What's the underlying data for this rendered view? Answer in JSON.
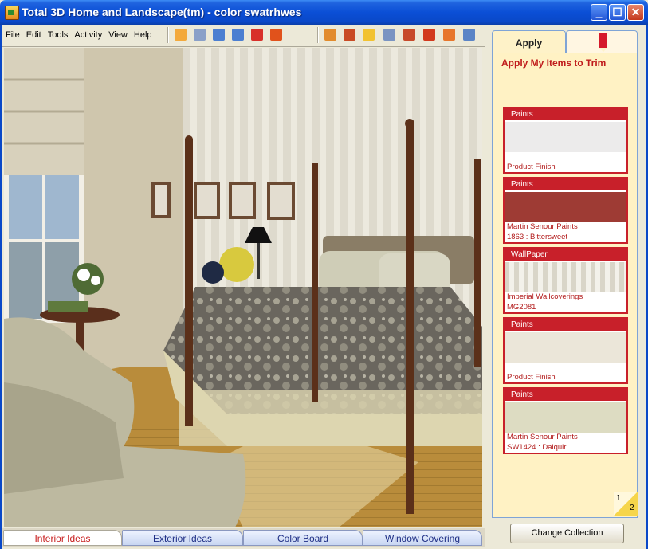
{
  "window": {
    "title": "Total 3D Home and Landscape(tm) - color swatrhwes"
  },
  "menu": [
    "File",
    "Edit",
    "Tools",
    "Activity",
    "View",
    "Help"
  ],
  "toolbar_icons": [
    "save-icon",
    "print-icon",
    "undo-icon",
    "redo-icon",
    "help-icon",
    "whats-this-icon",
    "catalog-icon",
    "house-icon",
    "lightbulb-icon",
    "materials-icon",
    "cart-icon",
    "book-icon",
    "rotate-icon",
    "zoom-icon"
  ],
  "bottom_tabs": [
    {
      "label": "Interior Ideas",
      "active": true
    },
    {
      "label": "Exterior Ideas",
      "active": false
    },
    {
      "label": "Color Board",
      "active": false
    },
    {
      "label": "Window Covering",
      "active": false
    }
  ],
  "panel": {
    "tab_apply": "Apply",
    "heading": "Apply My Items to Trim",
    "items": [
      {
        "category": "Paints",
        "lines": [
          "Product Finish"
        ],
        "swatch": "#ecebeb"
      },
      {
        "category": "Paints",
        "lines": [
          "Martin Senour Paints",
          "1863 : Bittersweet"
        ],
        "swatch": "#9e3b34"
      },
      {
        "category": "WallPaper",
        "lines": [
          "Imperial Wallcoverings",
          "MG2081"
        ],
        "swatch": "stripes"
      },
      {
        "category": "Paints",
        "lines": [
          "Product Finish"
        ],
        "swatch": "#ebe6d9"
      },
      {
        "category": "Paints",
        "lines": [
          "Martin Senour Paints",
          "SW1424 : Daiquiri"
        ],
        "swatch": "#dddcc2"
      }
    ],
    "pager": {
      "page1": "1",
      "page2": "2"
    },
    "change_collection": "Change Collection"
  },
  "colors": {
    "accent_red": "#c8202a",
    "panel_bg": "#fff2c4",
    "titlebar_blue": "#0a48c8"
  }
}
